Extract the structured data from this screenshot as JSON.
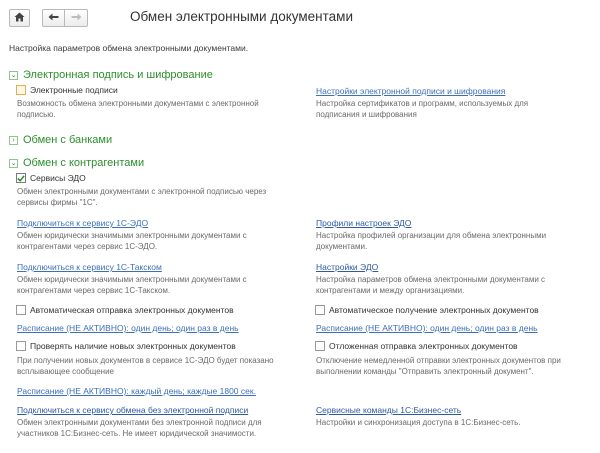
{
  "window": {
    "title": "Обмен электронными документами",
    "intro": "Настройка параметров обмена электронными документами."
  },
  "toolbar": {
    "home_icon": "home-icon",
    "back_icon": "arrow-left-icon",
    "forward_icon": "arrow-right-icon"
  },
  "sections": {
    "signature": {
      "title": "Электронная подпись и шифрование",
      "checkbox_label": "Электронные подписи",
      "checkbox_desc": "Возможность обмена электронными документами с электронной подписью.",
      "settings_link": "Настройки электронной подписи и шифрования",
      "settings_desc": "Настройка сертификатов и программ, используемых для подписания и шифрования"
    },
    "banks": {
      "title": "Обмен с банками"
    },
    "counterparties": {
      "title": "Обмен с контрагентами",
      "edo_label": "Сервисы ЭДО",
      "edo_desc": "Обмен электронными документами с электронной подписью через сервисы фирмы \"1С\".",
      "connect_1c_edo": "Подключиться к сервису 1С-ЭДО",
      "connect_1c_edo_desc": "Обмен юридически значимыми электронными документами с контрагентами через сервис 1С-ЭДО.",
      "profiles_link": "Профили настроек ЭДО",
      "profiles_desc": "Настройка профилей организации для обмена электронными документами.",
      "connect_taxcom": "Подключиться к сервису 1С-Такском",
      "connect_taxcom_desc": "Обмен юридически значимыми электронными документами с контрагентами через сервис 1С-Такском.",
      "edo_settings_link": "Настройки ЭДО",
      "edo_settings_desc": "Настройка параметров обмена электронными документами с контрагентами и между организациями.",
      "auto_send_label": "Автоматическая отправка электронных документов",
      "auto_receive_label": "Автоматическое получение электронных документов",
      "schedule_send": "Расписание (НЕ АКТИВНО): один день; один раз в день",
      "schedule_receive": "Расписание (НЕ АКТИВНО): один день; один раз в день",
      "check_new_label": "Проверять наличие новых электронных документов",
      "check_new_desc": "При получении новых документов в сервисе 1С-ЭДО будет показано всплывающее сообщение",
      "deferred_label": "Отложенная отправка электронных документов",
      "deferred_desc": "Отключение немедленной отправки электронных документов при выполнении команды \"Отправить электронный документ\".",
      "schedule_check": "Расписание (НЕ АКТИВНО): каждый  день; каждые 1800 сек.",
      "connect_nosign": "Подключиться к сервису обмена без электронной подписи",
      "connect_nosign_desc": "Обмен электронными документами без электронной подписи для участников 1С:Бизнес-сеть. Не имеет юридической значимости.",
      "service_cmds_link": "Сервисные команды 1С:Бизнес-сеть",
      "service_cmds_desc": "Настройки и синхронизация доступа в 1С:Бизнес-сеть."
    }
  },
  "colors": {
    "section_green": "#2d8f2d",
    "link_blue": "#3d6fb8",
    "checkmark": "#2d8f2d"
  }
}
